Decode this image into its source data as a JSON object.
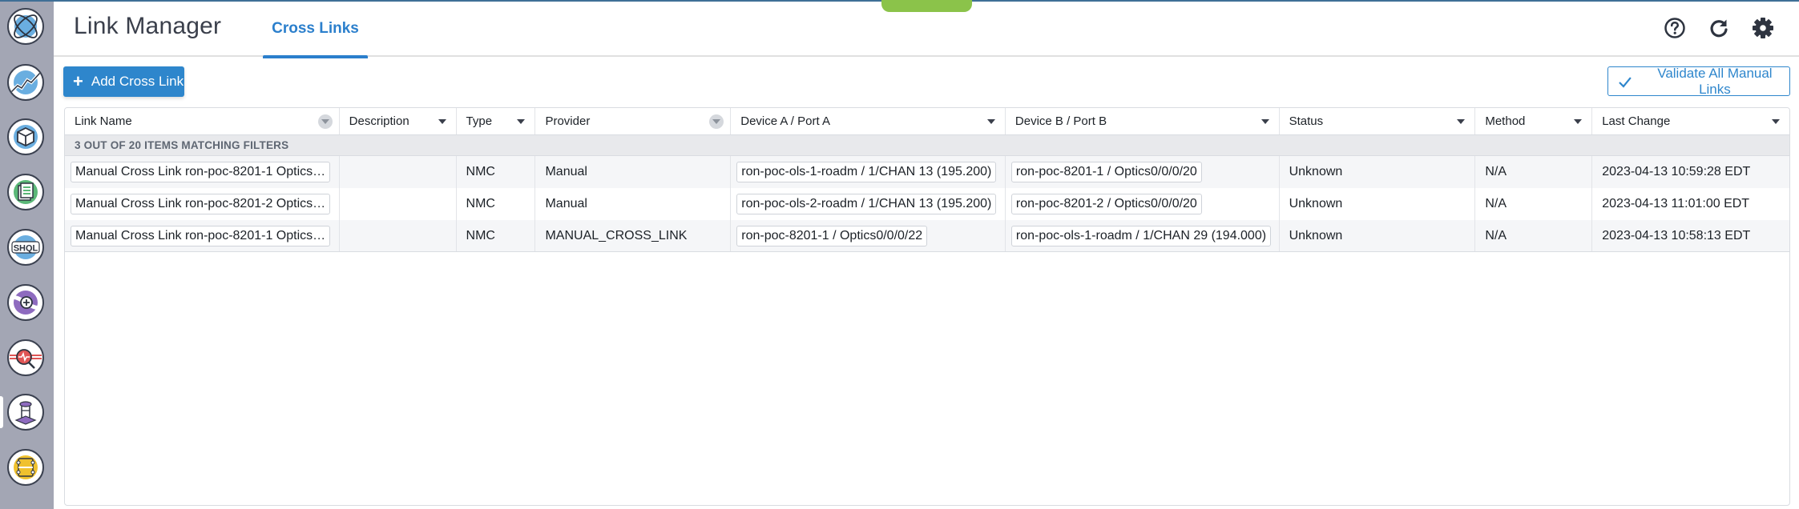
{
  "app": {
    "title": "Link Manager"
  },
  "tabs": [
    {
      "label": "Cross Links",
      "active": true
    }
  ],
  "header_icons": [
    "help-icon",
    "refresh-icon",
    "settings-icon"
  ],
  "sidebar": {
    "items": [
      {
        "name": "home-globe",
        "active": false
      },
      {
        "name": "analytics-trend",
        "active": false
      },
      {
        "name": "inventory-cube",
        "active": false
      },
      {
        "name": "reports-document",
        "active": false
      },
      {
        "name": "shql-query",
        "active": false
      },
      {
        "name": "add-connection",
        "active": false
      },
      {
        "name": "network-monitor",
        "active": false
      },
      {
        "name": "link-manager",
        "active": true
      },
      {
        "name": "device-module",
        "active": false
      }
    ],
    "shql_label": "SHQL"
  },
  "toolbar": {
    "add_label": "Add Cross Link",
    "validate_label": "Validate All Manual Links"
  },
  "table": {
    "columns": [
      {
        "label": "Link Name",
        "filter": "circle"
      },
      {
        "label": "Description",
        "filter": "arrow"
      },
      {
        "label": "Type",
        "filter": "arrow"
      },
      {
        "label": "Provider",
        "filter": "circle"
      },
      {
        "label": "Device A / Port A",
        "filter": "arrow"
      },
      {
        "label": "Device B / Port B",
        "filter": "arrow"
      },
      {
        "label": "Status",
        "filter": "arrow"
      },
      {
        "label": "Method",
        "filter": "arrow"
      },
      {
        "label": "Last Change",
        "filter": "arrow"
      }
    ],
    "group_label": "3 OUT OF 20 ITEMS MATCHING FILTERS",
    "rows": [
      {
        "link_name": "Manual Cross Link ron-poc-8201-1 Optics…",
        "description": "",
        "type": "NMC",
        "provider": "Manual",
        "device_a": "ron-poc-ols-1-roadm / 1/CHAN 13 (195.200)",
        "device_b": "ron-poc-8201-1 / Optics0/0/0/20",
        "status": "Unknown",
        "method": "N/A",
        "last_change": "2023-04-13 10:59:28 EDT"
      },
      {
        "link_name": "Manual Cross Link ron-poc-8201-2 Optics…",
        "description": "",
        "type": "NMC",
        "provider": "Manual",
        "device_a": "ron-poc-ols-2-roadm / 1/CHAN 13 (195.200)",
        "device_b": "ron-poc-8201-2 / Optics0/0/0/20",
        "status": "Unknown",
        "method": "N/A",
        "last_change": "2023-04-13 11:01:00 EDT"
      },
      {
        "link_name": "Manual Cross Link ron-poc-8201-1 Optics…",
        "description": "",
        "type": "NMC",
        "provider": "MANUAL_CROSS_LINK",
        "device_a": "ron-poc-8201-1 / Optics0/0/0/22",
        "device_b": "ron-poc-ols-1-roadm / 1/CHAN 29 (194.000)",
        "status": "Unknown",
        "method": "N/A",
        "last_change": "2023-04-13 10:58:13 EDT"
      }
    ]
  },
  "colors": {
    "accent": "#2e86cc",
    "sidebar": "#a3a6b4",
    "topbar_accent": "#8bc34a"
  }
}
